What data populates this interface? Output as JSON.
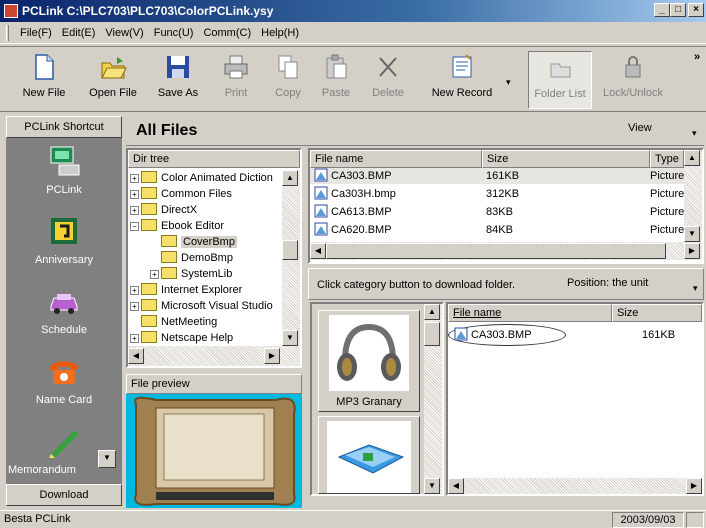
{
  "window": {
    "title": "PCLink C:\\PLC703\\PLC703\\ColorPCLink.ysy"
  },
  "menu": [
    "File(F)",
    "Edit(E)",
    "View(V)",
    "Func(U)",
    "Comm(C)",
    "Help(H)"
  ],
  "toolbar": {
    "new_file": "New File",
    "open_file": "Open File",
    "save_as": "Save As",
    "print": "Print",
    "copy": "Copy",
    "paste": "Paste",
    "delete": "Delete",
    "new_record": "New Record",
    "folder_list": "Folder List",
    "lock_unlock": "Lock/Unlock",
    "more": "»"
  },
  "shortcut": {
    "header": "PCLink Shortcut",
    "items": [
      {
        "label": "PCLink",
        "icon": "computer-icon"
      },
      {
        "label": "Anniversary",
        "icon": "calendar-icon"
      },
      {
        "label": "Schedule",
        "icon": "car-icon"
      },
      {
        "label": "Name Card",
        "icon": "phone-icon"
      },
      {
        "label": "Memorandum",
        "icon": "pen-icon"
      }
    ],
    "download": "Download"
  },
  "main": {
    "title": "All Files",
    "view_label": "View"
  },
  "dirtree": {
    "header": "Dir tree",
    "items": [
      {
        "label": "Color Animated Diction",
        "expander": "+",
        "indent": 0
      },
      {
        "label": "Common Files",
        "expander": "+",
        "indent": 0
      },
      {
        "label": "DirectX",
        "expander": "+",
        "indent": 0
      },
      {
        "label": "Ebook Editor",
        "expander": "−",
        "indent": 0
      },
      {
        "label": "CoverBmp",
        "expander": "",
        "indent": 1,
        "selected": true
      },
      {
        "label": "DemoBmp",
        "expander": "",
        "indent": 1
      },
      {
        "label": "SystemLib",
        "expander": "+",
        "indent": 1
      },
      {
        "label": "Internet Explorer",
        "expander": "+",
        "indent": 0
      },
      {
        "label": "Microsoft Visual Studio",
        "expander": "+",
        "indent": 0
      },
      {
        "label": "NetMeeting",
        "expander": "",
        "indent": 0
      },
      {
        "label": "Netscape Help",
        "expander": "+",
        "indent": 0
      }
    ]
  },
  "filelist": {
    "columns": [
      "File name",
      "Size",
      "Type"
    ],
    "rows": [
      {
        "name": "CA303.BMP",
        "size": "161KB",
        "type": "Picture"
      },
      {
        "name": "Ca303H.bmp",
        "size": "312KB",
        "type": "Picture"
      },
      {
        "name": "CA613.BMP",
        "size": "83KB",
        "type": "Picture"
      },
      {
        "name": "CA620.BMP",
        "size": "84KB",
        "type": "Picture"
      }
    ]
  },
  "preview": {
    "header": "File preview"
  },
  "download_area": {
    "hint": "Click category button to download folder.",
    "position": "Position: the unit",
    "categories": [
      "MP3 Granary",
      ""
    ],
    "columns": [
      "File name",
      "Size"
    ],
    "rows": [
      {
        "name": "CA303.BMP",
        "size": "161KB"
      }
    ]
  },
  "status": {
    "app": "Besta PCLink",
    "date": "2003/09/03"
  }
}
